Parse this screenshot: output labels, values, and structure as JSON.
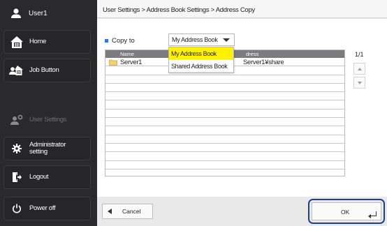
{
  "sidebar": {
    "user": {
      "label": "User1",
      "icon": "user-icon"
    },
    "items": [
      {
        "label": "Home",
        "icon": "home-icon",
        "enabled": true
      },
      {
        "label": "Job Button",
        "icon": "job-button-icon",
        "enabled": true
      },
      {
        "label": "User Settings",
        "icon": "user-settings-icon",
        "enabled": false
      },
      {
        "label": "Administrator setting",
        "icon": "gear-icon",
        "enabled": true
      },
      {
        "label": "Logout",
        "icon": "logout-icon",
        "enabled": true
      },
      {
        "label": "Power off",
        "icon": "power-icon",
        "enabled": true
      }
    ]
  },
  "breadcrumb": "User Settings > Address Book Settings > Address Copy",
  "copy_to": {
    "label": "Copy to",
    "selected": "My Address Book",
    "options": [
      "My Address Book",
      "Shared Address Book"
    ]
  },
  "table": {
    "columns": [
      "Name",
      "Address"
    ],
    "header_visible": {
      "name": "Name",
      "address": "dress"
    },
    "rows": [
      {
        "name": "Server1",
        "address": "¥Server1¥share",
        "address_visible": "Server1¥share"
      }
    ]
  },
  "page_counter": "1/1",
  "footer": {
    "cancel_label": "Cancel",
    "ok_label": "OK"
  },
  "colors": {
    "accent": "#2e7bd6",
    "dropdown_highlight": "#fff200",
    "focus_ring": "#1c3f8f",
    "sidebar_bg": "#2a2a2c"
  }
}
